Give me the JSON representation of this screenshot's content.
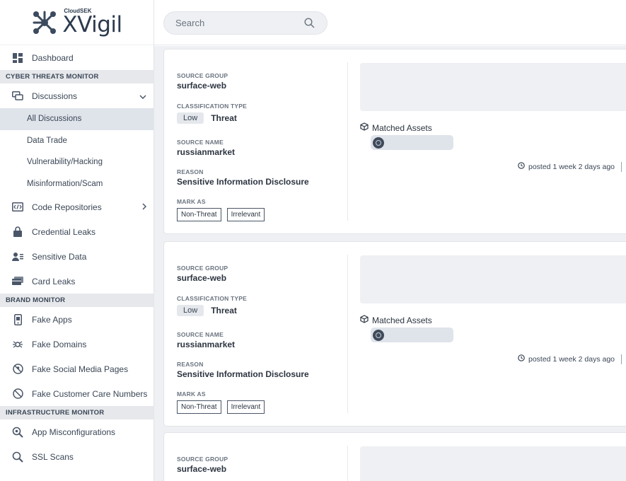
{
  "brand": {
    "small": "CloudSEK",
    "big": "XVigil"
  },
  "search": {
    "placeholder": "Search"
  },
  "sidebar": {
    "dashboard": "Dashboard",
    "sections": {
      "cyber": "CYBER THREATS MONITOR",
      "brand": "BRAND MONITOR",
      "infra": "INFRASTRUCTURE MONITOR"
    },
    "discussions": "Discussions",
    "discussion_subs": [
      "All Discussions",
      "Data Trade",
      "Vulnerability/Hacking",
      "Misinformation/Scam"
    ],
    "code_repositories": "Code Repositories",
    "credential_leaks": "Credential Leaks",
    "sensitive_data": "Sensitive Data",
    "card_leaks": "Card Leaks",
    "fake_apps": "Fake Apps",
    "fake_domains": "Fake Domains",
    "fake_social": "Fake Social Media Pages",
    "fake_customer_care": "Fake Customer Care Numbers",
    "app_misconfig": "App Misconfigurations",
    "ssl_scans": "SSL Scans"
  },
  "labels": {
    "source_group": "SOURCE GROUP",
    "classification_type": "CLASSIFICATION TYPE",
    "source_name": "SOURCE NAME",
    "reason": "REASON",
    "mark_as": "MARK AS",
    "matched_assets": "Matched Assets",
    "non_threat": "Non-Threat",
    "irrelevant": "Irrelevant"
  },
  "cards": [
    {
      "source_group": "surface-web",
      "severity": "Low",
      "classification": "Threat",
      "source_name": "russianmarket",
      "reason": "Sensitive Information Disclosure",
      "posted": "posted 1 week 2 days ago"
    },
    {
      "source_group": "surface-web",
      "severity": "Low",
      "classification": "Threat",
      "source_name": "russianmarket",
      "reason": "Sensitive Information Disclosure",
      "posted": "posted 1 week 2 days ago"
    },
    {
      "source_group": "surface-web"
    }
  ]
}
